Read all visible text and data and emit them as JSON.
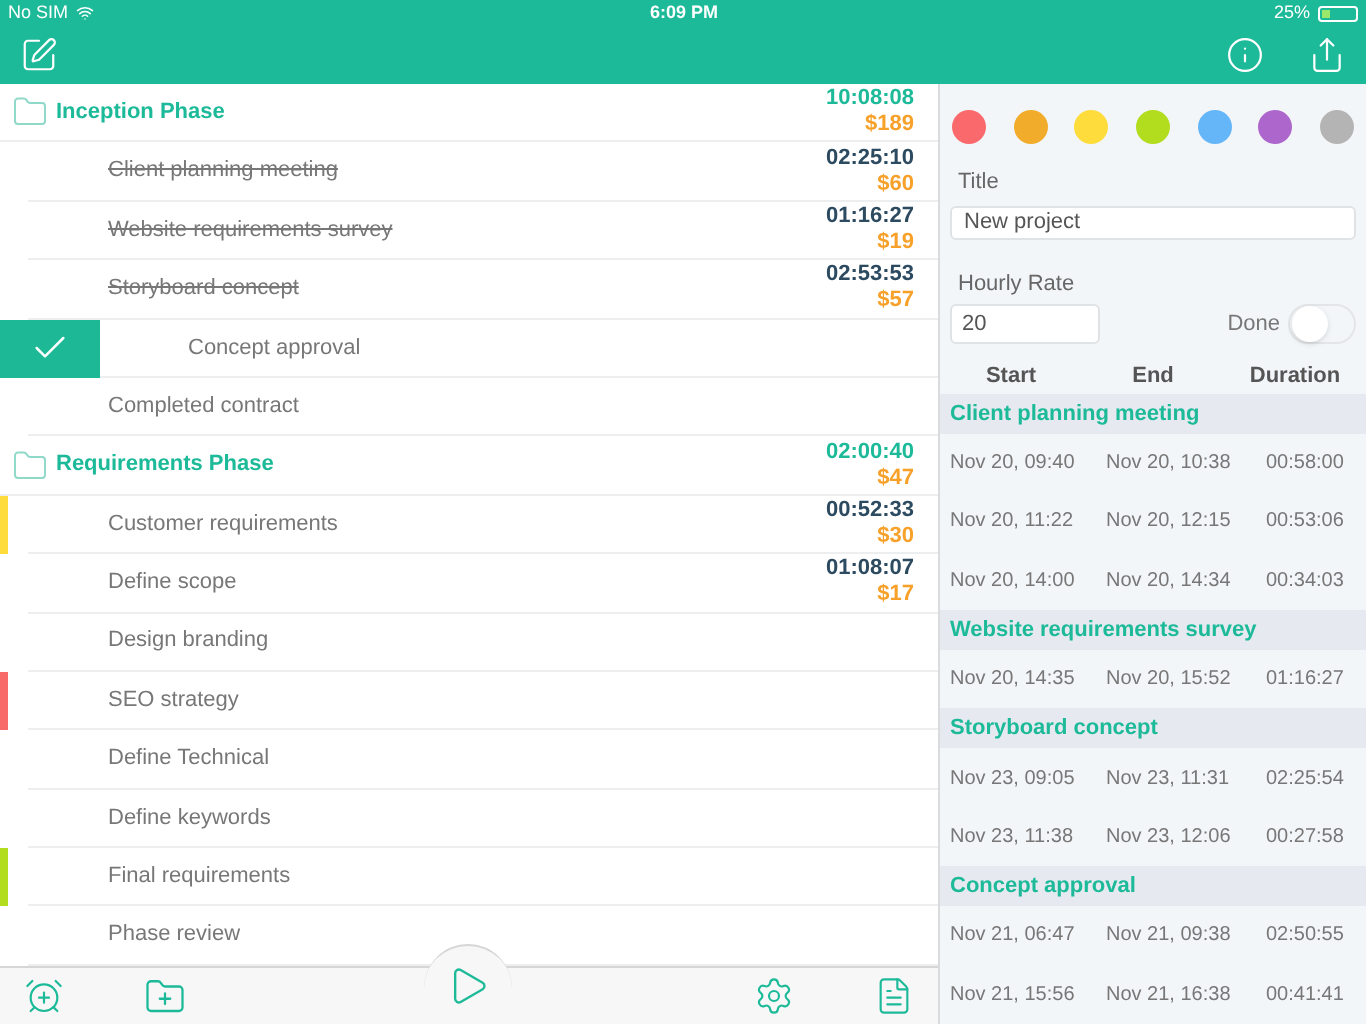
{
  "status_bar": {
    "carrier": "No SIM",
    "time": "6:09 PM",
    "battery": "25%"
  },
  "phases": [
    {
      "title": "Inception Phase",
      "time": "10:08:08",
      "cost": "$189",
      "children": [
        {
          "title": "Client planning meeting",
          "done": true,
          "time": "02:25:10",
          "cost": "$60"
        },
        {
          "title": "Website requirements survey",
          "done": true,
          "time": "01:16:27",
          "cost": "$19"
        },
        {
          "title": "Storyboard concept",
          "done": true,
          "time": "02:53:53",
          "cost": "$57"
        },
        {
          "title": "Concept approval",
          "done": false,
          "swiped": true
        },
        {
          "title": "Completed contract",
          "done": false
        }
      ]
    },
    {
      "title": "Requirements Phase",
      "time": "02:00:40",
      "cost": "$47",
      "children": [
        {
          "title": "Customer requirements",
          "done": false,
          "color": "#fddc3c",
          "time": "00:52:33",
          "cost": "$30"
        },
        {
          "title": "Define scope",
          "done": false,
          "time": "01:08:07",
          "cost": "$17"
        },
        {
          "title": "Design branding",
          "done": false
        },
        {
          "title": "SEO strategy",
          "done": false,
          "color": "#f86a6a"
        },
        {
          "title": "Define Technical",
          "done": false
        },
        {
          "title": "Define keywords",
          "done": false
        },
        {
          "title": "Final requirements",
          "done": false,
          "color": "#b2dc1e"
        },
        {
          "title": "Phase review",
          "done": false
        }
      ]
    }
  ],
  "detail": {
    "colors": [
      {
        "color": "#fa6a6c"
      },
      {
        "color": "#f2ac2c"
      },
      {
        "color": "#fddc3c"
      },
      {
        "color": "#b2dc1e"
      },
      {
        "color": "#64b6f8"
      },
      {
        "color": "#ac66cc"
      },
      {
        "color": "#b4b4b4"
      }
    ],
    "title_label": "Title",
    "title_value": "New project",
    "rate_label": "Hourly Rate",
    "rate_value": "20",
    "done_label": "Done",
    "done": false,
    "columns": [
      "Start",
      "End",
      "Duration"
    ],
    "groups": [
      {
        "title": "Client planning meeting",
        "entries": [
          [
            "Nov 20, 09:40",
            "Nov 20, 10:38",
            "00:58:00"
          ],
          [
            "Nov 20, 11:22",
            "Nov 20, 12:15",
            "00:53:06"
          ],
          [
            "Nov 20, 14:00",
            "Nov 20, 14:34",
            "00:34:03"
          ]
        ]
      },
      {
        "title": "Website requirements survey",
        "entries": [
          [
            "Nov 20, 14:35",
            "Nov 20, 15:52",
            "01:16:27"
          ]
        ]
      },
      {
        "title": "Storyboard concept",
        "entries": [
          [
            "Nov 23, 09:05",
            "Nov 23, 11:31",
            "02:25:54"
          ],
          [
            "Nov 23, 11:38",
            "Nov 23, 12:06",
            "00:27:58"
          ]
        ]
      },
      {
        "title": "Concept approval",
        "entries": [
          [
            "Nov 21, 06:47",
            "Nov 21, 09:38",
            "02:50:55"
          ],
          [
            "Nov 21, 15:56",
            "Nov 21, 16:38",
            "00:41:41"
          ]
        ]
      }
    ]
  }
}
